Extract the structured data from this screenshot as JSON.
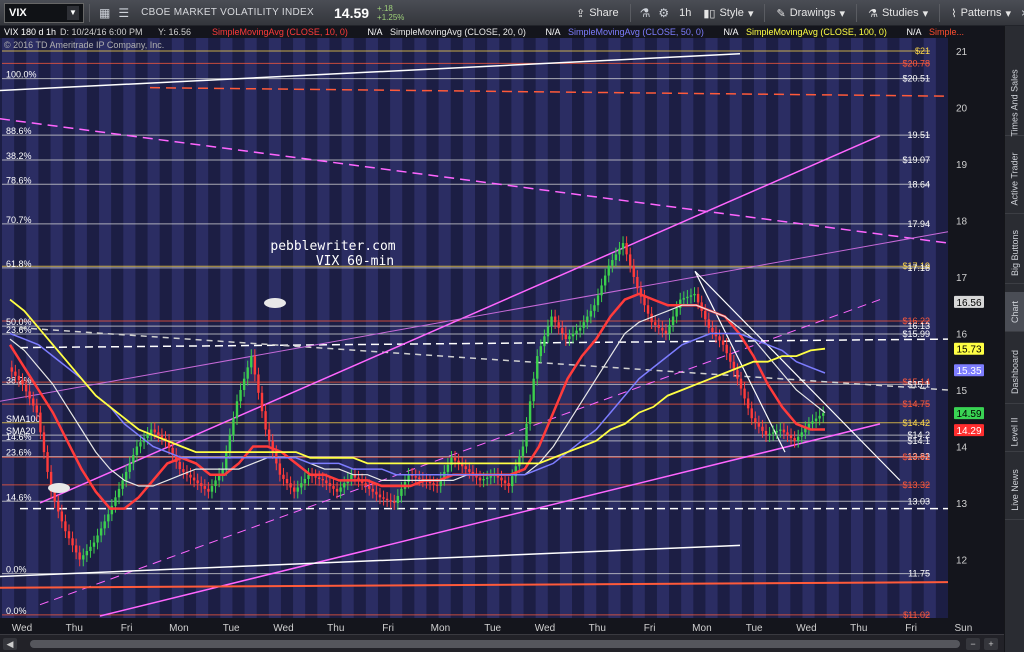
{
  "toolbar": {
    "symbol": "VIX",
    "description": "CBOE MARKET VOLATILITY INDEX",
    "last": "14.59",
    "change": "+.18",
    "change_pct": "+1.25%",
    "share": "Share",
    "interval": "1h",
    "style": "Style",
    "drawings": "Drawings",
    "studies": "Studies",
    "patterns": "Patterns"
  },
  "sidebar": {
    "tabs": [
      "Times And Sales",
      "Active Trader",
      "Big Buttons",
      "Chart",
      "Dashboard",
      "Level II",
      "Live News"
    ]
  },
  "header": {
    "title": "VIX 180 d 1h",
    "date": "D: 10/24/16 6:00 PM",
    "y": "Y: 16.56",
    "studies": [
      {
        "label": "SimpleMovingAvg (CLOSE, 10, 0)",
        "value": "N/A",
        "color": "#ff3b3b"
      },
      {
        "label": "SimpleMovingAvg (CLOSE, 20, 0)",
        "value": "N/A",
        "color": "#e8e8e8"
      },
      {
        "label": "SimpleMovingAvg (CLOSE, 50, 0)",
        "value": "N/A",
        "color": "#7d7dff"
      },
      {
        "label": "SimpleMovingAvg (CLOSE, 100, 0)",
        "value": "N/A",
        "color": "#ffff44"
      },
      {
        "label": "Simple...",
        "value": "",
        "color": "#ff4d2e"
      }
    ],
    "copyright": "© 2016 TD Ameritrade IP Company, Inc."
  },
  "chart_data": {
    "type": "line",
    "title": "VIX 180 d 1h",
    "annotation": [
      "pebblewriter.com",
      "VIX 60-min"
    ],
    "x_labels": [
      "Wed",
      "Thu",
      "Fri",
      "Mon",
      "Tue",
      "Wed",
      "Thu",
      "Fri",
      "Mon",
      "Tue",
      "Wed",
      "Thu",
      "Fri",
      "Mon",
      "Tue",
      "Wed",
      "Thu",
      "Fri",
      "Sun"
    ],
    "ylim": [
      11.0,
      21.3
    ],
    "y_ticks": [
      12,
      13,
      14,
      15,
      16,
      17,
      18,
      19,
      20,
      21
    ],
    "series": [
      {
        "name": "VIX",
        "color": "#ff3b3b",
        "values": [
          15.4,
          15.1,
          14.6,
          13.2,
          12.5,
          12.0,
          12.3,
          12.8,
          13.4,
          14.0,
          14.3,
          14.1,
          13.6,
          13.4,
          13.2,
          13.6,
          14.8,
          15.6,
          14.3,
          13.5,
          13.2,
          13.5,
          13.4,
          13.2,
          13.5,
          13.3,
          13.1,
          13.0,
          13.5,
          13.4,
          13.3,
          13.8,
          13.6,
          13.4,
          13.5,
          13.3,
          14.0,
          15.6,
          16.3,
          15.9,
          16.1,
          16.5,
          17.2,
          17.6,
          16.8,
          16.2,
          16.0,
          16.6,
          16.7,
          16.1,
          15.8,
          15.2,
          14.5,
          14.2,
          14.3,
          14.1,
          14.4,
          14.59
        ]
      },
      {
        "name": "SMA10",
        "color": "#ff3b3b",
        "values": [
          15.8,
          15.4,
          15.0,
          14.6,
          14.1,
          13.6,
          13.2,
          12.9,
          12.9,
          13.1,
          13.4,
          13.7,
          13.8,
          13.7,
          13.5,
          13.5,
          13.7,
          14.0,
          14.0,
          13.9,
          13.7,
          13.5,
          13.5,
          13.4,
          13.4,
          13.4,
          13.3,
          13.3,
          13.3,
          13.4,
          13.4,
          13.5,
          13.5,
          13.5,
          13.5,
          13.5,
          13.6,
          14.0,
          14.6,
          15.2,
          15.6,
          15.9,
          16.3,
          16.6,
          16.7,
          16.6,
          16.5,
          16.5,
          16.5,
          16.4,
          16.3,
          16.0,
          15.6,
          15.1,
          14.7,
          14.4,
          14.3,
          14.3
        ]
      },
      {
        "name": "SMA20",
        "color": "#e8e8e8",
        "values": [
          15.9,
          15.7,
          15.4,
          15.1,
          14.7,
          14.3,
          13.9,
          13.6,
          13.4,
          13.3,
          13.3,
          13.4,
          13.5,
          13.6,
          13.6,
          13.6,
          13.6,
          13.7,
          13.8,
          13.8,
          13.8,
          13.7,
          13.6,
          13.6,
          13.5,
          13.5,
          13.4,
          13.4,
          13.4,
          13.4,
          13.4,
          13.4,
          13.5,
          13.5,
          13.5,
          13.5,
          13.5,
          13.7,
          14.0,
          14.4,
          14.8,
          15.2,
          15.6,
          16.0,
          16.2,
          16.3,
          16.4,
          16.5,
          16.5,
          16.4,
          16.3,
          16.1,
          15.9,
          15.6,
          15.3,
          15.0,
          14.8,
          14.6
        ]
      },
      {
        "name": "SMA50",
        "color": "#7d7dff",
        "values": [
          16.0,
          15.9,
          15.8,
          15.6,
          15.4,
          15.2,
          14.9,
          14.7,
          14.4,
          14.2,
          14.0,
          13.9,
          13.8,
          13.8,
          13.8,
          13.8,
          13.8,
          13.8,
          13.8,
          13.8,
          13.8,
          13.7,
          13.7,
          13.7,
          13.6,
          13.6,
          13.6,
          13.5,
          13.5,
          13.5,
          13.5,
          13.5,
          13.5,
          13.5,
          13.5,
          13.5,
          13.5,
          13.6,
          13.7,
          13.9,
          14.1,
          14.3,
          14.6,
          14.9,
          15.2,
          15.4,
          15.6,
          15.8,
          15.9,
          16.0,
          16.0,
          16.0,
          15.9,
          15.8,
          15.7,
          15.5,
          15.4,
          15.3
        ]
      },
      {
        "name": "SMA100",
        "color": "#ffff44",
        "values": [
          16.6,
          16.4,
          16.1,
          15.8,
          15.5,
          15.2,
          14.9,
          14.7,
          14.5,
          14.3,
          14.2,
          14.1,
          14.0,
          13.9,
          13.9,
          13.9,
          13.9,
          13.9,
          13.9,
          13.9,
          13.9,
          13.8,
          13.8,
          13.8,
          13.8,
          13.7,
          13.7,
          13.7,
          13.7,
          13.7,
          13.7,
          13.7,
          13.7,
          13.7,
          13.7,
          13.7,
          13.7,
          13.7,
          13.8,
          13.9,
          14.0,
          14.1,
          14.3,
          14.4,
          14.6,
          14.7,
          14.9,
          15.0,
          15.1,
          15.2,
          15.3,
          15.4,
          15.5,
          15.5,
          15.6,
          15.6,
          15.7,
          15.73
        ]
      }
    ],
    "price_labels": [
      {
        "text": "$21",
        "value": 21.0,
        "color": "#ffd84a"
      },
      {
        "text": "$20.78",
        "value": 20.78,
        "color": "#ff5a3a"
      },
      {
        "text": "$20.51",
        "value": 20.51,
        "color": "#ffffff"
      },
      {
        "text": "19.51",
        "value": 19.51,
        "color": "#ffffff"
      },
      {
        "text": "$19.07",
        "value": 19.07,
        "color": "#ffffff"
      },
      {
        "text": "18.64",
        "value": 18.64,
        "color": "#ffffff"
      },
      {
        "text": "17.94",
        "value": 17.94,
        "color": "#ffffff"
      },
      {
        "text": "$17.19",
        "value": 17.19,
        "color": "#ffd84a"
      },
      {
        "text": "17.16",
        "value": 17.16,
        "color": "#ffffff"
      },
      {
        "text": "$16.22",
        "value": 16.22,
        "color": "#ff5a3a"
      },
      {
        "text": "16.13",
        "value": 16.13,
        "color": "#ffffff"
      },
      {
        "text": "$15.99",
        "value": 15.99,
        "color": "#ffffff"
      },
      {
        "text": "$15.14",
        "value": 15.14,
        "color": "#ff5a3a"
      },
      {
        "text": "$15.1",
        "value": 15.1,
        "color": "#ffffff"
      },
      {
        "text": "$14.75",
        "value": 14.75,
        "color": "#ff5a3a"
      },
      {
        "text": "$14.42",
        "value": 14.42,
        "color": "#ffd84a"
      },
      {
        "text": "$14.2",
        "value": 14.2,
        "color": "#ffffff"
      },
      {
        "text": "$14.1",
        "value": 14.1,
        "color": "#ffffff"
      },
      {
        "text": "13.82",
        "value": 13.82,
        "color": "#ffffff"
      },
      {
        "text": "$13.81",
        "value": 13.81,
        "color": "#ff5a3a"
      },
      {
        "text": "$13.32",
        "value": 13.32,
        "color": "#ff5a3a"
      },
      {
        "text": "13.03",
        "value": 13.03,
        "color": "#ffffff"
      },
      {
        "text": "11.75",
        "value": 11.75,
        "color": "#ffffff"
      },
      {
        "text": "$11.02",
        "value": 11.02,
        "color": "#ff5a3a"
      }
    ],
    "fib_labels": [
      {
        "text": "100.0%",
        "value": 20.51
      },
      {
        "text": "88.6%",
        "value": 19.51
      },
      {
        "text": "38.2%",
        "value": 19.07
      },
      {
        "text": "78.6%",
        "value": 18.64
      },
      {
        "text": "70.7%",
        "value": 17.94
      },
      {
        "text": "61.8%",
        "value": 17.16
      },
      {
        "text": "50.0%",
        "value": 16.13
      },
      {
        "text": "23.6%",
        "value": 15.99
      },
      {
        "text": "38.2%",
        "value": 15.1
      },
      {
        "text": "SMA100",
        "value": 14.42
      },
      {
        "text": "SMA20",
        "value": 14.2
      },
      {
        "text": "14.6%",
        "value": 14.1
      },
      {
        "text": "23.6%",
        "value": 13.82
      },
      {
        "text": "14.6%",
        "value": 13.03
      },
      {
        "text": "0.0%",
        "value": 11.75
      },
      {
        "text": "0.0%",
        "value": 11.02
      }
    ],
    "right_badges": [
      {
        "text": "16.56",
        "value": 16.56,
        "bg": "#d8d8d8",
        "fg": "#000000"
      },
      {
        "text": "15.73",
        "value": 15.73,
        "bg": "#ffff44",
        "fg": "#000000"
      },
      {
        "text": "15.35",
        "value": 15.35,
        "bg": "#7d7dff",
        "fg": "#ffffff"
      },
      {
        "text": "14.59",
        "value": 14.59,
        "bg": "#39d353",
        "fg": "#000000"
      },
      {
        "text": "14.29",
        "value": 14.29,
        "bg": "#ff2e2e",
        "fg": "#ffffff"
      }
    ]
  }
}
